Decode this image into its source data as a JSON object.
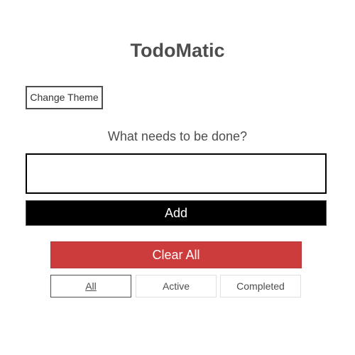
{
  "app": {
    "title": "TodoMatic"
  },
  "toolbar": {
    "theme_label": "Change Theme"
  },
  "form": {
    "prompt": "What needs to be done?",
    "input_value": "",
    "add_label": "Add"
  },
  "actions": {
    "clear_label": "Clear All"
  },
  "filters": {
    "selected": "All",
    "items": [
      {
        "label": "All"
      },
      {
        "label": "Active"
      },
      {
        "label": "Completed"
      }
    ]
  },
  "colors": {
    "text": "#4d4d4d",
    "add_button_bg": "#000000",
    "clear_button_bg": "#cd3c3c"
  }
}
